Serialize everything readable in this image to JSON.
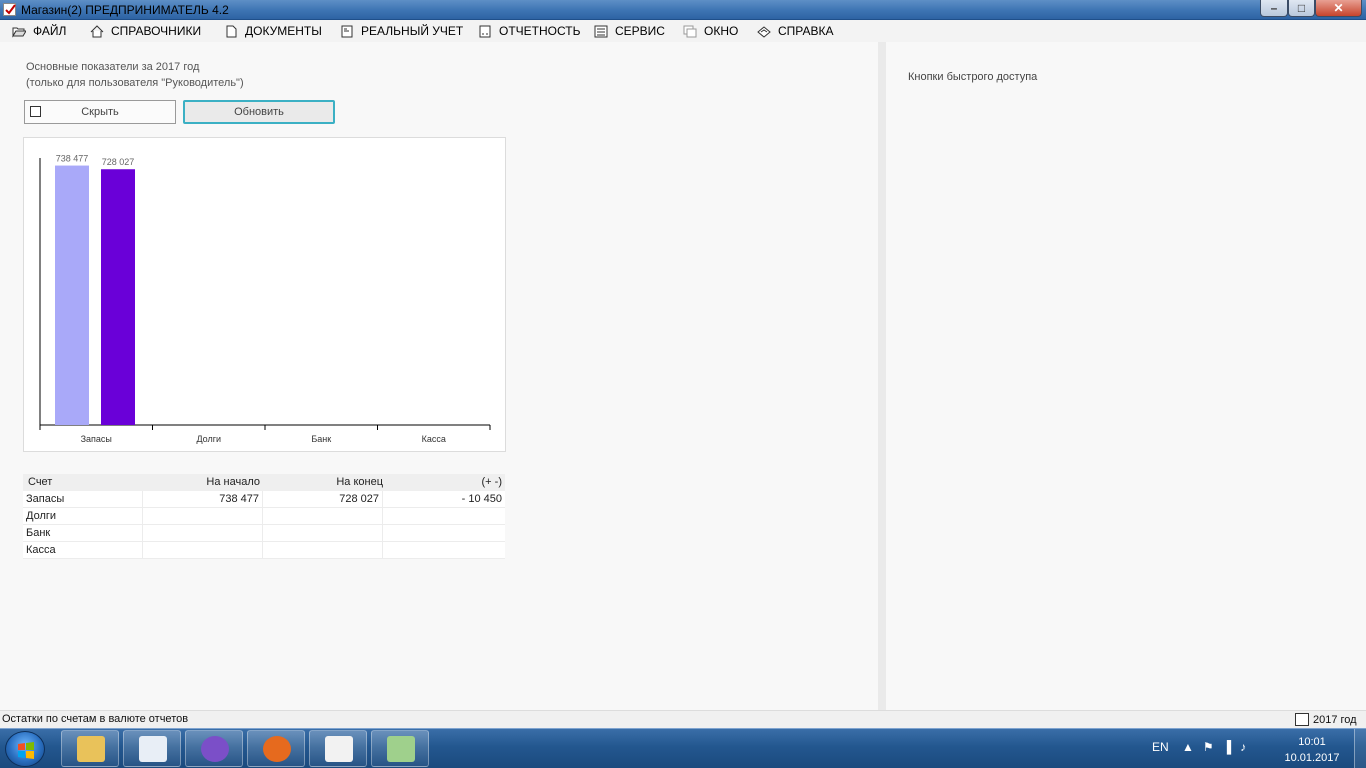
{
  "window": {
    "title": "Магазин(2)  ПРЕДПРИНИМАТЕЛЬ 4.2",
    "min_glyph": "–",
    "max_glyph": "□",
    "close_glyph": "✕"
  },
  "menu": [
    {
      "label": "ФАЙЛ",
      "icon": "folder-open-icon"
    },
    {
      "label": "СПРАВОЧНИКИ",
      "icon": "home-icon"
    },
    {
      "label": "ДОКУМЕНТЫ",
      "icon": "document-icon"
    },
    {
      "label": "РЕАЛЬНЫЙ УЧЕТ",
      "icon": "ledger-icon"
    },
    {
      "label": "ОТЧЕТНОСТЬ",
      "icon": "report-icon"
    },
    {
      "label": "СЕРВИС",
      "icon": "calculator-icon"
    },
    {
      "label": "ОКНО",
      "icon": "windows-icon"
    },
    {
      "label": "СПРАВКА",
      "icon": "help-book-icon"
    }
  ],
  "main": {
    "heading_line1": "Основные показатели за 2017 год",
    "heading_line2": "(только для пользователя \"Руководитель\")",
    "hide_button": "Скрыть",
    "refresh_button": "Обновить"
  },
  "chart_data": {
    "type": "bar",
    "categories": [
      "Запасы",
      "Долги",
      "Банк",
      "Касса"
    ],
    "series": [
      {
        "values": [
          738477,
          null,
          null,
          null
        ],
        "color": "#a9a9f9"
      },
      {
        "values": [
          728027,
          null,
          null,
          null
        ],
        "color": "#6a00d8"
      }
    ],
    "value_labels": [
      "738 477",
      "728 027"
    ],
    "ylim": [
      0,
      760000
    ],
    "grid": false,
    "legend": "none"
  },
  "table": {
    "headers": [
      "Счет",
      "На начало",
      "На конец",
      "(+ -)"
    ],
    "rows": [
      [
        "Запасы",
        "738 477",
        "728 027",
        "- 10 450"
      ],
      [
        "Долги",
        "",
        "",
        ""
      ],
      [
        "Банк",
        "",
        "",
        ""
      ],
      [
        "Касса",
        "",
        "",
        ""
      ]
    ]
  },
  "right_panel": {
    "title": "Кнопки быстрого доступа"
  },
  "status": {
    "left": "Остатки по счетам в валюте отчетов",
    "year": "2017 год"
  },
  "taskbar": {
    "apps": [
      {
        "name": "explorer-icon",
        "color": "#e9c25a"
      },
      {
        "name": "document-app-icon",
        "color": "#e8eef6"
      },
      {
        "name": "viber-icon",
        "color": "#7b4fc8"
      },
      {
        "name": "firefox-icon",
        "color": "#e66a1e"
      },
      {
        "name": "predprinimatel-app-icon",
        "color": "#f2f2f2"
      },
      {
        "name": "spreadsheet-app-icon",
        "color": "#9fd08c"
      }
    ],
    "lang": "EN",
    "tray_glyphs": [
      "▲",
      "⚑",
      "▐",
      "♪"
    ],
    "time": "10:01",
    "date": "10.01.2017"
  }
}
